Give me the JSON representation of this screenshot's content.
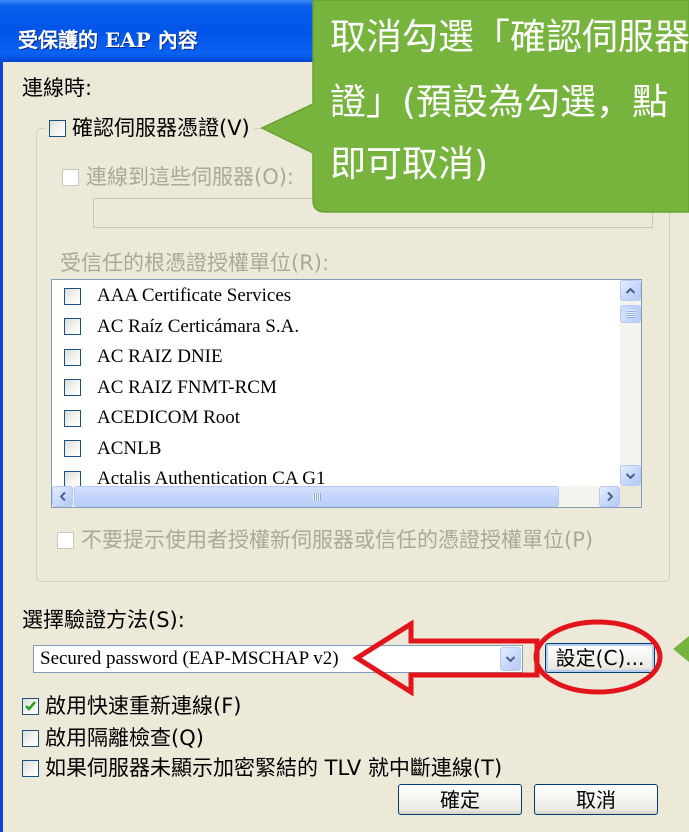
{
  "window": {
    "title": "受保護的 EAP 內容"
  },
  "callout": {
    "lines": [
      "取消勾選「確認伺服器",
      "證」(預設為勾選，點",
      "即可取消)"
    ]
  },
  "connect": {
    "heading": "連線時:",
    "validate_server_cert": {
      "label": "確認伺服器憑證(V)",
      "checked": false
    },
    "connect_to_servers": {
      "label": "連線到這些伺服器(O):",
      "checked": false,
      "enabled": false,
      "value": ""
    },
    "trusted_root_ca": {
      "label": "受信任的根憑證授權單位(R):",
      "items": [
        {
          "label": "AAA Certificate Services",
          "checked": false
        },
        {
          "label": "AC Raíz Certicámara S.A.",
          "checked": false
        },
        {
          "label": "AC RAIZ DNIE",
          "checked": false
        },
        {
          "label": "AC RAIZ FNMT-RCM",
          "checked": false
        },
        {
          "label": "ACEDICOM Root",
          "checked": false
        },
        {
          "label": "ACNLB",
          "checked": false
        },
        {
          "label": "Actalis Authentication CA G1",
          "checked": false
        }
      ]
    },
    "do_not_prompt": {
      "label": "不要提示使用者授權新伺服器或信任的憑證授權單位(P)",
      "checked": false,
      "enabled": false
    }
  },
  "auth_method": {
    "label": "選擇驗證方法(S):",
    "selected": "Secured password (EAP-MSCHAP v2)",
    "configure_button": "設定(C)..."
  },
  "options": [
    {
      "label": "啟用快速重新連線(F)",
      "checked": true
    },
    {
      "label": "啟用隔離檢查(Q)",
      "checked": false
    },
    {
      "label": "如果伺服器未顯示加密緊結的 TLV 就中斷連線(T)",
      "checked": false
    }
  ],
  "buttons": {
    "ok": "確定",
    "cancel": "取消"
  },
  "icons": [
    "check-icon",
    "scroll-up-icon",
    "scroll-down-icon",
    "scroll-left-icon",
    "scroll-right-icon",
    "dropdown-arrow-icon"
  ],
  "colors": {
    "callout": "#76b43e",
    "annotation_red": "#e3141c",
    "title_bar": "#0055e8",
    "dialog_bg": "#ece9d8",
    "check": "#21a121"
  }
}
